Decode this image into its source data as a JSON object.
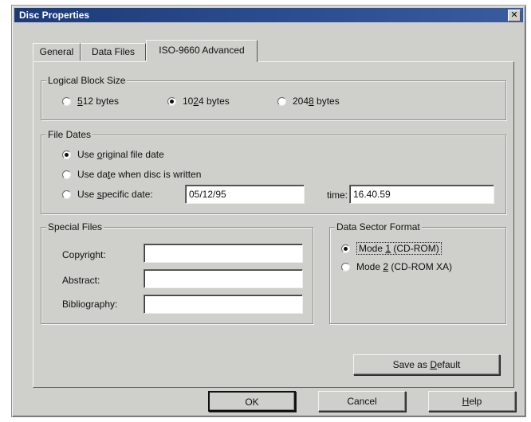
{
  "window": {
    "title": "Disc Properties",
    "close_glyph": "✕"
  },
  "tabs": [
    {
      "label": "General"
    },
    {
      "label": "Data Files"
    },
    {
      "label": "ISO-9660 Advanced"
    }
  ],
  "active_tab": "ISO-9660 Advanced",
  "logical_block_size": {
    "title": "Logical Block Size",
    "options": [
      {
        "pre": "",
        "u": "5",
        "post": "12 bytes",
        "checked": false
      },
      {
        "pre": "10",
        "u": "2",
        "post": "4 bytes",
        "checked": true
      },
      {
        "pre": "204",
        "u": "8",
        "post": " bytes",
        "checked": false
      }
    ]
  },
  "file_dates": {
    "title": "File Dates",
    "options": [
      {
        "pre": "Use ",
        "u": "o",
        "post": "riginal file date",
        "checked": true
      },
      {
        "pre": "Use da",
        "u": "t",
        "post": "e when disc is written",
        "checked": false
      },
      {
        "pre": "Use ",
        "u": "s",
        "post": "pecific date:",
        "checked": false
      }
    ],
    "date_value": "05/12/95",
    "time_label": "time:",
    "time_value": "16.40.59"
  },
  "special_files": {
    "title": "Special Files",
    "fields": [
      {
        "label": "Copyright:",
        "value": ""
      },
      {
        "label": "Abstract:",
        "value": ""
      },
      {
        "label": "Bibliography:",
        "value": ""
      }
    ]
  },
  "data_sector_format": {
    "title": "Data Sector Format",
    "options": [
      {
        "pre": "Mode ",
        "u": "1",
        "post": " (CD-ROM)",
        "checked": true
      },
      {
        "pre": "Mode ",
        "u": "2",
        "post": " (CD-ROM XA)",
        "checked": false
      }
    ]
  },
  "buttons": {
    "save_default": {
      "pre": "Save as ",
      "u": "D",
      "post": "efault"
    },
    "ok": "OK",
    "cancel": "Cancel",
    "help": {
      "u": "H",
      "post": "elp"
    }
  },
  "colors": {
    "face": "#cfcfcb",
    "titlebar": "#1c3a78"
  }
}
